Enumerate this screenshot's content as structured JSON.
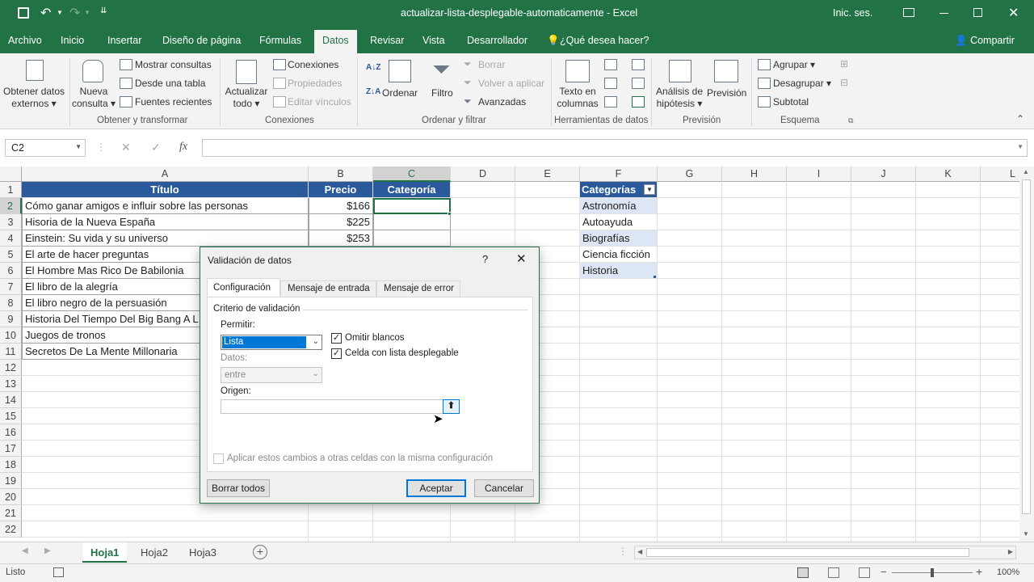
{
  "window": {
    "title": "actualizar-lista-desplegable-automaticamente - Excel",
    "signin": "Inic. ses."
  },
  "ribbon_tabs": [
    "Archivo",
    "Inicio",
    "Insertar",
    "Diseño de página",
    "Fórmulas",
    "Datos",
    "Revisar",
    "Vista",
    "Desarrollador"
  ],
  "tell_me": "¿Qué desea hacer?",
  "share": "Compartir",
  "ribbon": {
    "ext_data": [
      "Obtener datos",
      "externos"
    ],
    "new_query": [
      "Nueva",
      "consulta"
    ],
    "show_queries": "Mostrar consultas",
    "from_table": "Desde una tabla",
    "recent_sources": "Fuentes recientes",
    "group_get": "Obtener y transformar",
    "refresh": [
      "Actualizar",
      "todo"
    ],
    "connections": "Conexiones",
    "properties": "Propiedades",
    "edit_links": "Editar vínculos",
    "group_conn": "Conexiones",
    "sort": "Ordenar",
    "filter": "Filtro",
    "clear": "Borrar",
    "reapply": "Volver a aplicar",
    "advanced": "Avanzadas",
    "group_sort": "Ordenar y filtrar",
    "text_cols": [
      "Texto en",
      "columnas"
    ],
    "group_tools": "Herramientas de datos",
    "whatif": [
      "Análisis de",
      "hipótesis"
    ],
    "forecast": "Previsión",
    "group_forecast": "Previsión",
    "group_btn": "Agrupar",
    "ungroup": "Desagrupar",
    "subtotal": "Subtotal",
    "group_outline": "Esquema"
  },
  "namebox": "C2",
  "formula_fx": "fx",
  "columns": [
    "A",
    "B",
    "C",
    "D",
    "E",
    "F",
    "G",
    "H",
    "I",
    "J",
    "K",
    "L"
  ],
  "rows": [
    "1",
    "2",
    "3",
    "4",
    "5",
    "6",
    "7",
    "8",
    "9",
    "10",
    "11",
    "12",
    "13",
    "14",
    "15",
    "16",
    "17",
    "18",
    "19",
    "20",
    "21",
    "22"
  ],
  "table_headers": {
    "titulo": "Título",
    "precio": "Precio",
    "categoria": "Categoría"
  },
  "books": [
    {
      "title": "Cómo ganar amigos e influir sobre las personas",
      "price": "$166"
    },
    {
      "title": "Hisoria de la Nueva España",
      "price": "$225"
    },
    {
      "title": "Einstein: Su vida y su universo",
      "price": "$253"
    },
    {
      "title": "El arte de hacer preguntas",
      "price": ""
    },
    {
      "title": "El Hombre Mas Rico De Babilonia",
      "price": ""
    },
    {
      "title": "El libro de la alegría",
      "price": ""
    },
    {
      "title": "El libro negro de la persuasión",
      "price": ""
    },
    {
      "title": "Historia Del Tiempo Del Big Bang A L",
      "price": ""
    },
    {
      "title": "Juegos de tronos",
      "price": ""
    },
    {
      "title": "Secretos De La Mente Millonaria",
      "price": ""
    }
  ],
  "categories_header": "Categorías",
  "categories": [
    "Astronomía",
    "Autoayuda",
    "Biografías",
    "Ciencia ficción",
    "Historia"
  ],
  "sheets": [
    "Hoja1",
    "Hoja2",
    "Hoja3"
  ],
  "status": {
    "ready": "Listo",
    "zoom": "100%"
  },
  "dialog": {
    "title": "Validación de datos",
    "help": "?",
    "tabs": [
      "Configuración",
      "Mensaje de entrada",
      "Mensaje de error"
    ],
    "criteria": "Criterio de validación",
    "allow_label": "Permitir:",
    "allow_value": "Lista",
    "ignore_blank": "Omitir blancos",
    "in_cell_dropdown": "Celda con lista desplegable",
    "data_label": "Datos:",
    "data_value": "entre",
    "source_label": "Origen:",
    "apply_all": "Aplicar estos cambios a otras celdas con la misma configuración",
    "clear_all": "Borrar todos",
    "ok": "Aceptar",
    "cancel": "Cancelar"
  }
}
